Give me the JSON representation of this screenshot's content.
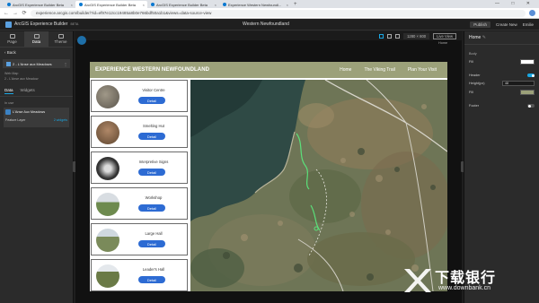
{
  "browser": {
    "tabs": [
      {
        "label": "ArcGIS Experience Builder Beta",
        "active": false
      },
      {
        "label": "ArcGIS Experience Builder Beta",
        "active": true
      },
      {
        "label": "ArcGIS Experience Builder Beta",
        "active": false
      },
      {
        "label": "Experience Western Newfoundl...",
        "active": false
      }
    ],
    "new_tab": "+",
    "window_controls": "— □ ✕",
    "url": "experience.arcgis.com/builder/?id=ef97e12cc19485a8b0e766bdf50a1b1&views=data-source-view",
    "nav": {
      "back": "←",
      "forward": "→",
      "reload": "⟳"
    }
  },
  "builder": {
    "brand": "ArcGIS Experience Builder",
    "brand_badge": "BETA",
    "experience_title": "Western Newfoundland",
    "publish": "Publish",
    "create_new": "Create New",
    "user": "Emilie"
  },
  "left_panel": {
    "tabs": [
      {
        "label": "Page",
        "active": false
      },
      {
        "label": "Data",
        "active": true
      },
      {
        "label": "Theme",
        "active": false
      }
    ],
    "back_label": "Back",
    "page_item": "2 - L'Anse aux Meadows",
    "web_map_label": "Web Map",
    "web_map_name": "2 - L'Anse aux Meadow",
    "subtabs": [
      "Data",
      "Widgets"
    ],
    "in_use_label": "In use",
    "datasource": {
      "name": "L'Anse Aux Meadows",
      "layer": "Feature Layer",
      "link": "2 widgets"
    }
  },
  "canvas": {
    "resolution": "1280 × 800",
    "live_view": "Live View",
    "home_tag": "Home",
    "page": {
      "header_title": "EXPERIENCE WESTERN NEWFOUNDLAND",
      "nav": [
        "Home",
        "The Viking Trail",
        "Plan Your Visit"
      ],
      "header_color": "#9ca17a",
      "cards": [
        {
          "title": "Visitor Centre",
          "button": "Detail",
          "thumb": "#7a7368"
        },
        {
          "title": "Smelting Hut",
          "button": "Detail",
          "thumb": "#8a6a4c"
        },
        {
          "title": "Interpretive Signs",
          "button": "Detail",
          "thumb": "#4a4a4a"
        },
        {
          "title": "Workshop",
          "button": "Detail",
          "thumb": "#6d8a4e"
        },
        {
          "title": "Large Hall",
          "button": "Detail",
          "thumb": "#7a8a5a"
        },
        {
          "title": "Leader's Hall",
          "button": "Detail",
          "thumb": "#6a7a46"
        }
      ]
    }
  },
  "right_panel": {
    "title": "Home",
    "body_label": "Body",
    "fill_label": "Fill",
    "header_label": "Header",
    "height_label": "Height(px)",
    "height_value": "48",
    "header_fill_label": "Fill",
    "header_fill_color": "#9ca17a",
    "footer_label": "Footer",
    "body_fill_color": "#ffffff"
  },
  "watermark": {
    "title": "下载银行",
    "site": "www.downbank.cn"
  },
  "colors": {
    "accent": "#19a7e3",
    "button_blue": "#2d6bd3",
    "dark_bg": "#1e1e1e"
  }
}
